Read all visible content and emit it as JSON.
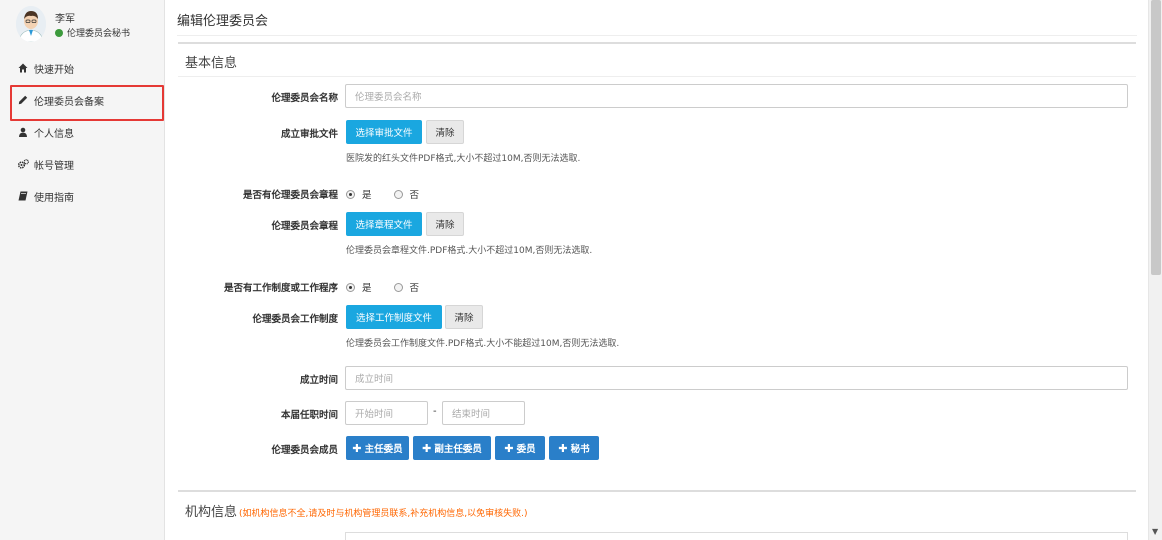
{
  "user": {
    "name": "李军",
    "role": "伦理委员会秘书",
    "status_color": "#3c9a3c"
  },
  "sidebar": {
    "items": [
      {
        "label": "快速开始",
        "icon": "home-icon"
      },
      {
        "label": "伦理委员会备案",
        "icon": "pencil-icon",
        "active": true
      },
      {
        "label": "个人信息",
        "icon": "user-icon"
      },
      {
        "label": "帐号管理",
        "icon": "gears-icon"
      },
      {
        "label": "使用指南",
        "icon": "book-icon"
      }
    ]
  },
  "page": {
    "title": "编辑伦理委员会"
  },
  "basic": {
    "heading": "基本信息",
    "name_label": "伦理委员会名称",
    "name_placeholder": "伦理委员会名称",
    "approval_label": "成立审批文件",
    "approval_select": "选择审批文件",
    "approval_clear": "清除",
    "approval_help": "医院发的红头文件PDF格式,大小不超过10M,否则无法选取.",
    "has_charter_label": "是否有伦理委员会章程",
    "yes": "是",
    "no": "否",
    "charter_label": "伦理委员会章程",
    "charter_select": "选择章程文件",
    "charter_clear": "清除",
    "charter_help": "伦理委员会章程文件.PDF格式.大小不超过10M,否则无法选取.",
    "has_rules_label": "是否有工作制度或工作程序",
    "rules_label": "伦理委员会工作制度",
    "rules_select": "选择工作制度文件",
    "rules_clear": "清除",
    "rules_help": "伦理委员会工作制度文件.PDF格式.大小不能超过10M,否则无法选取.",
    "founded_label": "成立时间",
    "founded_placeholder": "成立时间",
    "term_label": "本届任职时间",
    "term_start_placeholder": "开始时间",
    "term_dash": "-",
    "term_end_placeholder": "结束时间",
    "members_label": "伦理委员会成员",
    "member_buttons": [
      "主任委员",
      "副主任委员",
      "委员",
      "秘书"
    ]
  },
  "institution": {
    "heading": "机构信息",
    "note": "(如机构信息不全,请及时与机构管理员联系,补充机构信息,以免审核失败.)"
  },
  "colors": {
    "primary_button": "#1aa7e0",
    "member_button": "#2a7fc9",
    "warning_text": "#ff6600",
    "active_outline": "#e53935"
  }
}
